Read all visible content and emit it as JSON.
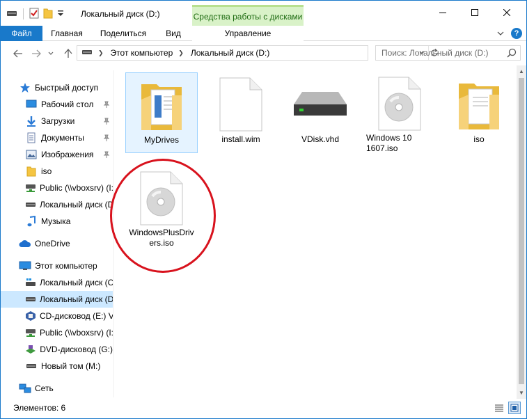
{
  "window": {
    "title": "Локальный диск (D:)"
  },
  "titlebar": {
    "contextual_header": "Средства работы с дисками",
    "minimize_icon": "minimize-icon",
    "maximize_icon": "maximize-icon",
    "close_icon": "close-icon"
  },
  "ribbon": {
    "tabs": [
      {
        "label": "Файл"
      },
      {
        "label": "Главная"
      },
      {
        "label": "Поделиться"
      },
      {
        "label": "Вид"
      },
      {
        "label": "Управление"
      }
    ],
    "help_label": "?"
  },
  "address": {
    "breadcrumbs": [
      "Этот компьютер",
      "Локальный диск (D:)"
    ]
  },
  "search": {
    "placeholder": "Поиск: Локальный диск (D:)"
  },
  "navpane": {
    "items": [
      {
        "label": "Быстрый доступ"
      },
      {
        "label": "Рабочий стол"
      },
      {
        "label": "Загрузки"
      },
      {
        "label": "Документы"
      },
      {
        "label": "Изображения"
      },
      {
        "label": "iso"
      },
      {
        "label": "Public (\\\\vboxsrv) (I:)"
      },
      {
        "label": "Локальный диск (D:)"
      },
      {
        "label": "Музыка"
      },
      {
        "label": "OneDrive"
      },
      {
        "label": "Этот компьютер"
      },
      {
        "label": "Локальный диск (C:)"
      },
      {
        "label": "Локальный диск (D:)"
      },
      {
        "label": "CD-дисковод (E:) VirtualBox"
      },
      {
        "label": "Public (\\\\vboxsrv) (I:)"
      },
      {
        "label": "DVD-дисковод (G:)"
      },
      {
        "label": "Новый том (M:)"
      },
      {
        "label": "Сеть"
      }
    ]
  },
  "files": [
    {
      "name": "MyDrives",
      "type": "folder-with-documents"
    },
    {
      "name": "install.wim",
      "type": "blank-file"
    },
    {
      "name": "VDisk.vhd",
      "type": "hard-drive"
    },
    {
      "name": "Windows 10 1607.iso",
      "type": "disc-image"
    },
    {
      "name": "iso",
      "type": "folder-with-documents"
    },
    {
      "name": "WindowsPlusDrivers.iso",
      "type": "disc-image"
    }
  ],
  "status": {
    "items_count": "Элементов: 6"
  },
  "colors": {
    "accent": "#1979ca",
    "contextual": "#d9f2c8",
    "annotation": "#d8121d",
    "selection": "#cce8ff"
  }
}
